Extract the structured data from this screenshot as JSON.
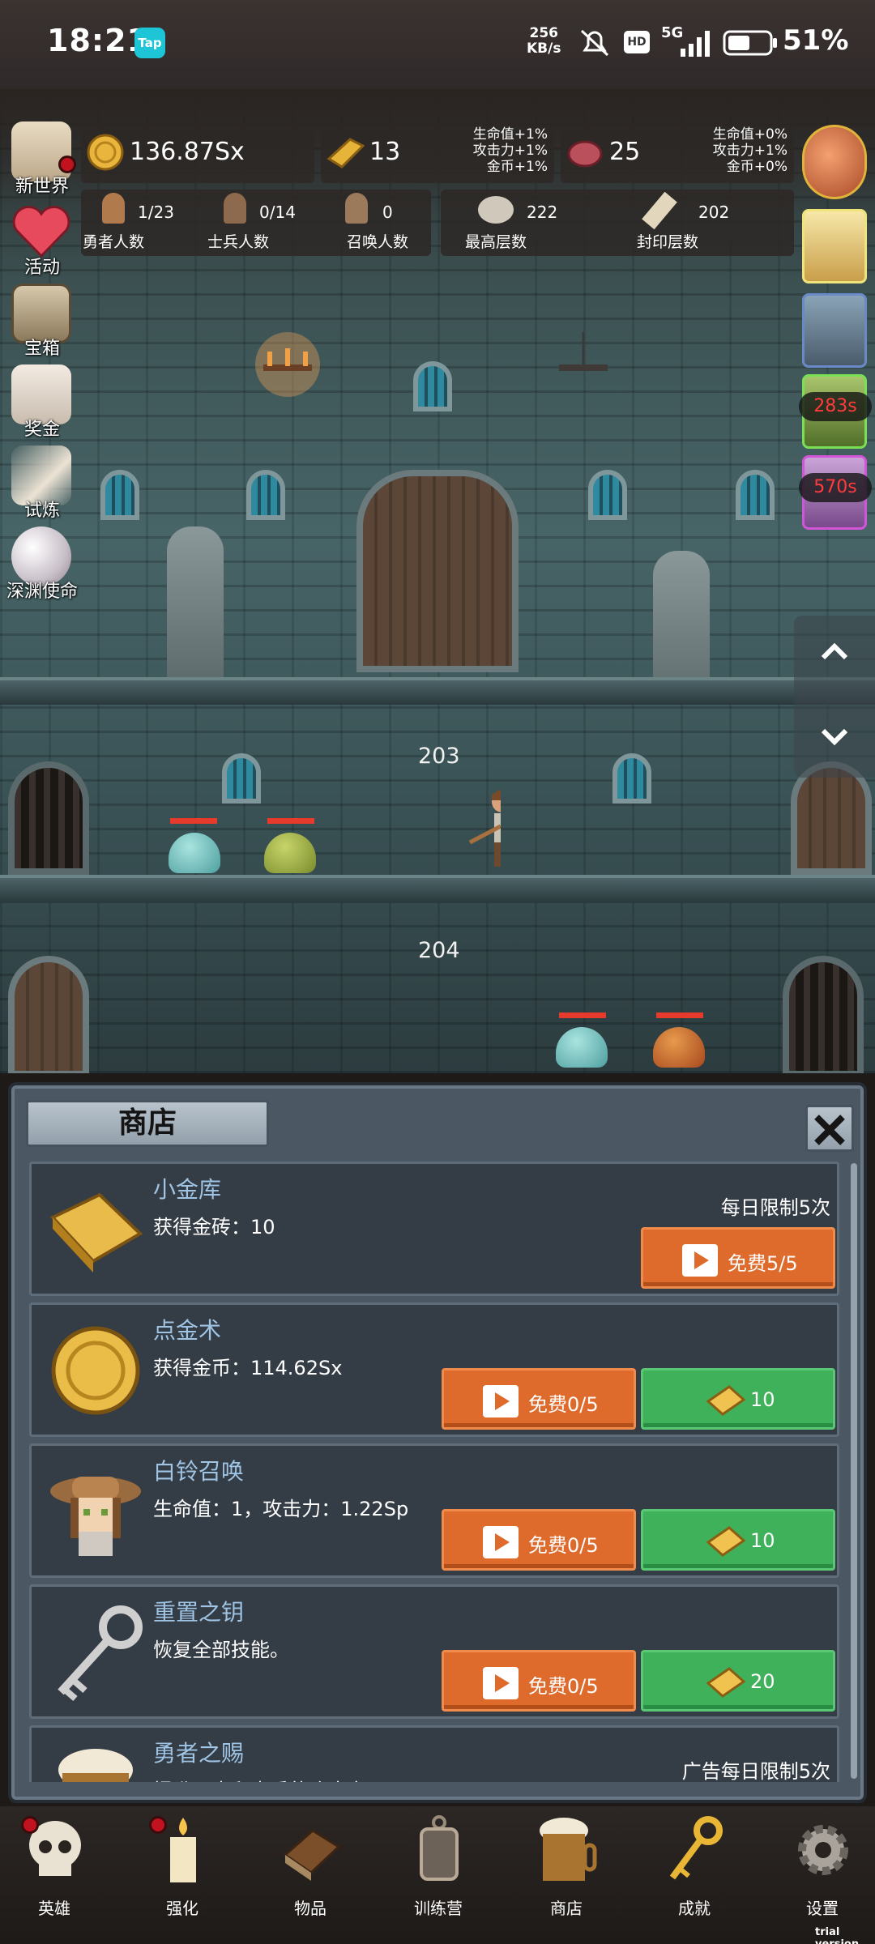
{
  "status_bar": {
    "time": "18:21",
    "tap_badge": "Tap",
    "net_speed_value": "256",
    "net_speed_unit": "KB/s",
    "hd_badge": "HD",
    "network": "5G",
    "battery": "51%"
  },
  "resources": {
    "gold_coin": "136.87Sx",
    "gold_brick": "13",
    "gold_brick_bonus": [
      "生命值+1%",
      "攻击力+1%",
      "金币+1%"
    ],
    "meat": "25",
    "meat_bonus": [
      "生命值+0%",
      "攻击力+1%",
      "金币+0%"
    ]
  },
  "counts": {
    "heroes_value": "1/23",
    "heroes_label": "勇者人数",
    "soldiers_value": "0/14",
    "soldiers_label": "士兵人数",
    "summons_value": "0",
    "summons_label": "召唤人数",
    "max_floor_value": "222",
    "max_floor_label": "最高层数",
    "seal_floor_value": "202",
    "seal_floor_label": "封印层数"
  },
  "left_menu": [
    {
      "label": "新世界",
      "icon": "map-scroll-icon",
      "badge": true
    },
    {
      "label": "活动",
      "icon": "heart-icon",
      "badge": false
    },
    {
      "label": "宝箱",
      "icon": "treasure-chest-icon",
      "badge": false
    },
    {
      "label": "奖金",
      "icon": "envelope-icon",
      "badge": false
    },
    {
      "label": "试炼",
      "icon": "feather-quill-icon",
      "badge": false
    },
    {
      "label": "深渊使命",
      "icon": "pearl-orb-icon",
      "badge": false
    }
  ],
  "right_menu": {
    "timer1": "283s",
    "timer2": "570s"
  },
  "floors": {
    "floor_a": "203",
    "floor_b": "204"
  },
  "shop": {
    "title": "商店",
    "items": [
      {
        "name": "小金库",
        "desc": "获得金砖：10",
        "limit": "每日限制5次",
        "ad_label": "免费5/5",
        "gold_label": ""
      },
      {
        "name": "点金术",
        "desc": "获得金币：114.62Sx",
        "limit": "",
        "ad_label": "免费0/5",
        "gold_label": "10"
      },
      {
        "name": "白铃召唤",
        "desc": "生命值：1，攻击力：1.22Sp",
        "limit": "",
        "ad_label": "免费0/5",
        "gold_label": "10"
      },
      {
        "name": "重置之钥",
        "desc": "恢复全部技能。",
        "limit": "",
        "ad_label": "免费0/5",
        "gold_label": "20"
      },
      {
        "name": "勇者之赐",
        "desc": "提升勇士和士兵的攻击力。",
        "limit": "广告每日限制5次",
        "ad_label": "",
        "gold_label": ""
      }
    ]
  },
  "nav": [
    {
      "label": "英雄",
      "icon": "skull-icon",
      "badge": true
    },
    {
      "label": "强化",
      "icon": "candle-icon",
      "badge": true
    },
    {
      "label": "物品",
      "icon": "book-icon",
      "badge": false
    },
    {
      "label": "训练营",
      "icon": "lantern-icon",
      "badge": false
    },
    {
      "label": "商店",
      "icon": "beer-mug-icon",
      "badge": false
    },
    {
      "label": "成就",
      "icon": "golden-key-icon",
      "badge": false
    },
    {
      "label": "设置",
      "icon": "gear-icon",
      "badge": false
    }
  ],
  "watermark": "trial version",
  "colors": {
    "ad_button": "#de6a2c",
    "gold_button": "#3eb15a",
    "item_name": "#9fc4e4",
    "timer_text": "#ff3b3b"
  }
}
